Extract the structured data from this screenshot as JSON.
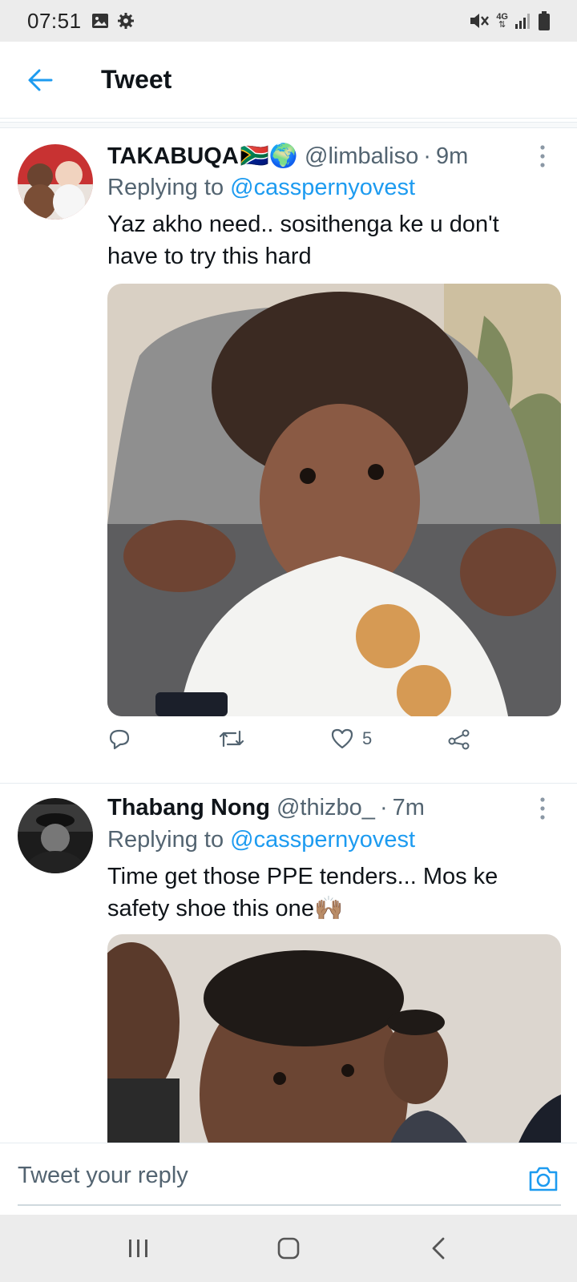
{
  "status_bar": {
    "time": "07:51",
    "left_icons": [
      "image-icon",
      "gear-icon"
    ],
    "right_icons": [
      "mute-icon",
      "network-4g-icon",
      "signal-icon",
      "battery-icon"
    ],
    "network_label": "4G"
  },
  "header": {
    "title": "Tweet",
    "back_icon": "back-arrow-icon"
  },
  "tweets": [
    {
      "display_name": "TAKABUQA",
      "name_emoji": "🇿🇦🌍",
      "handle": "@limbaliso",
      "separator": "·",
      "time": "9m",
      "replying_prefix": "Replying to",
      "replying_to": "@casspernyovest",
      "text": "Yaz akho need.. sosithenga ke u don't have to try this hard",
      "actions": {
        "reply_count": "",
        "retweet_count": "",
        "like_count": "5"
      }
    },
    {
      "display_name": "Thabang Nong",
      "handle": "@thizbo_",
      "separator": "·",
      "time": "7m",
      "replying_prefix": "Replying to",
      "replying_to": "@casspernyovest",
      "text": "Time get those PPE tenders... Mos ke safety shoe this one🙌🏽"
    }
  ],
  "reply_bar": {
    "placeholder": "Tweet your reply",
    "camera_icon": "camera-icon"
  },
  "nav_bar": {
    "buttons": [
      "recent-apps-icon",
      "home-icon",
      "back-icon"
    ]
  },
  "colors": {
    "accent": "#1d9bf0",
    "secondary_text": "#536471",
    "primary_text": "#0f1419",
    "system_bar": "#ececec"
  }
}
